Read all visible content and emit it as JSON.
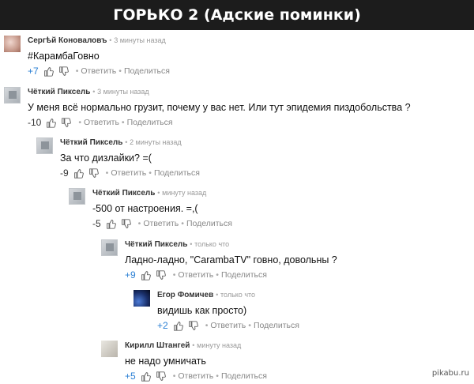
{
  "title": "ГОРЬКО 2 (Адские поминки)",
  "actions": {
    "reply": "Ответить",
    "share": "Поделиться"
  },
  "comments": [
    {
      "author": "Сергѣй Коноваловъ",
      "time": "3 минуты назад",
      "text": "#КарамбаГовно",
      "score": "+7",
      "avatar": "red-avatar"
    },
    {
      "author": "Чёткий Пиксель",
      "time": "3 минуты назад",
      "text": "У меня всё нормально грузит, почему у вас нет. Или тут эпидемия пиздобольства ?",
      "score": "-10",
      "avatar": "gray-avatar"
    },
    {
      "author": "Чёткий Пиксель",
      "time": "2 минуты назад",
      "text": "За что дизлайки? =(",
      "score": "-9",
      "avatar": "gray-avatar"
    },
    {
      "author": "Чёткий Пиксель",
      "time": "минуту назад",
      "text": "-500 от настроения. =,(",
      "score": "-5",
      "avatar": "gray-avatar"
    },
    {
      "author": "Чёткий Пиксель",
      "time": "только что",
      "text": "Ладно-ладно, \"CarambaTV\" говно, довольны ?",
      "score": "+9",
      "avatar": "gray-avatar"
    },
    {
      "author": "Егор Фомичев",
      "time": "только что",
      "text": "видишь как просто)",
      "score": "+2",
      "avatar": "dark-avatar"
    },
    {
      "author": "Кирилл Штангей",
      "time": "минуту назад",
      "text": "не надо умничать",
      "score": "+5",
      "avatar": "light-avatar"
    }
  ],
  "watermark": "pikabu.ru"
}
